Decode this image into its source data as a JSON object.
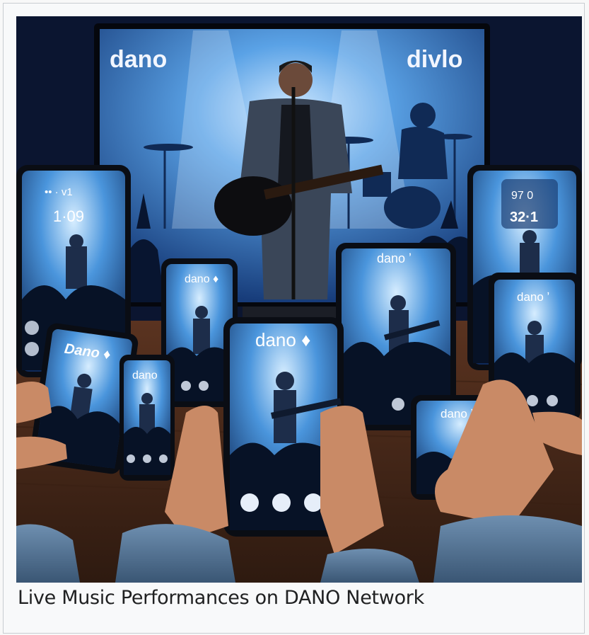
{
  "caption": "Live Music Performances on DANO Network",
  "screen": {
    "logo_left": "dano",
    "logo_right": "divlo"
  },
  "devices": {
    "phone_left_top": {
      "status": "•• ·  v1",
      "time": "1·09"
    },
    "phone_right_top": {
      "line1": "97 0",
      "line2": "32·1"
    },
    "phone_left_tilted": {
      "logo": "Dano ♦"
    },
    "phone_small_left": {
      "logo": "dano"
    },
    "phone_mid_left": {
      "logo": "dano ♦"
    },
    "phone_center": {
      "logo": "dano ♦"
    },
    "tablet_center_right": {
      "logo": "dano ʼ"
    },
    "phone_right_mid": {
      "logo": "dano ʼ"
    },
    "phone_bottom_right": {
      "logo": "dano ʼ"
    }
  },
  "colors": {
    "screen_blue": "#3f8ad6",
    "glow": "#9fd0ff",
    "stage_dark": "#0c1a3a",
    "wood": "#4a2a1a"
  }
}
